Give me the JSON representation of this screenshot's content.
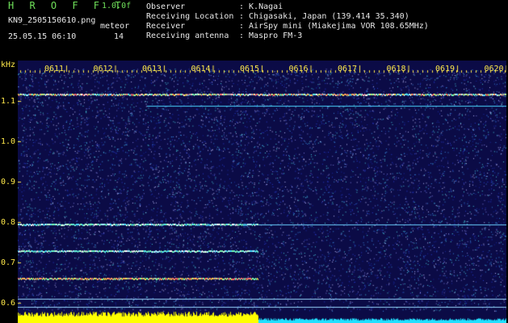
{
  "header": {
    "title": "H R O F F T",
    "version": "1.0.0f",
    "filename": "KN9_2505150610.png",
    "detector": "meteor",
    "datetime": "25.05.15 06:10",
    "count": "14",
    "fields": [
      {
        "label": "Observer",
        "value": ": K.Nagai"
      },
      {
        "label": "Receiving Location",
        "value": ": Chigasaki, Japan (139.414 35.340)"
      },
      {
        "label": "Receiver",
        "value": ": AirSpy mini (Miakejima VOR 108.65MHz)"
      },
      {
        "label": "Receiving antenna",
        "value": ": Maspro FM-3"
      }
    ]
  },
  "spectrogram": {
    "y_unit": "kHz",
    "y_ticks": [
      "1.1",
      "1.0",
      "0.9",
      "0.8",
      "0.7",
      "0.6"
    ],
    "x_ticks": [
      "0611",
      "0612",
      "0613",
      "0614",
      "0615",
      "0616",
      "0617",
      "0618",
      "0619",
      "0620"
    ],
    "colors": {
      "background": "#0b0b46",
      "text": "#ffe94a",
      "header_green": "#6fe05a",
      "signal_pre": "#ffff00",
      "signal_post": "#22e0ff"
    }
  }
}
